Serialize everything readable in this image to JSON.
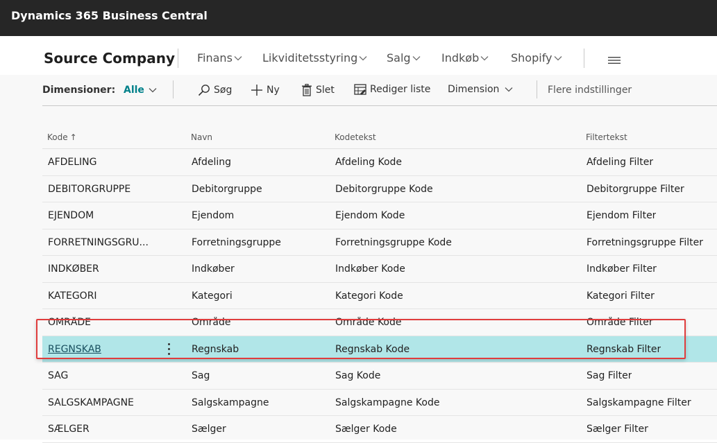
{
  "app": {
    "title": "Dynamics 365 Business Central"
  },
  "nav": {
    "company": "Source Company",
    "items": [
      {
        "label": "Finans"
      },
      {
        "label": "Likviditetsstyring"
      },
      {
        "label": "Salg"
      },
      {
        "label": "Indkøb"
      },
      {
        "label": "Shopify"
      }
    ]
  },
  "toolbar": {
    "filter_label": "Dimensioner:",
    "filter_value": "Alle",
    "search_label": "Søg",
    "new_label": "Ny",
    "delete_label": "Slet",
    "edit_list_label": "Rediger liste",
    "dimension_label": "Dimension",
    "more_label": "Flere indstillinger"
  },
  "table": {
    "columns": [
      "Kode",
      "Navn",
      "Kodetekst",
      "Filtertekst"
    ],
    "sort_indicator": "↑",
    "rows": [
      {
        "code": "AFDELING",
        "name": "Afdeling",
        "code_caption": "Afdeling Kode",
        "filter_caption": "Afdeling Filter"
      },
      {
        "code": "DEBITORGRUPPE",
        "name": "Debitorgruppe",
        "code_caption": "Debitorgruppe Kode",
        "filter_caption": "Debitorgruppe Filter"
      },
      {
        "code": "EJENDOM",
        "name": "Ejendom",
        "code_caption": "Ejendom Kode",
        "filter_caption": "Ejendom Filter"
      },
      {
        "code": "FORRETNINGSGRU...",
        "name": "Forretningsgruppe",
        "code_caption": "Forretningsgruppe Kode",
        "filter_caption": "Forretningsgruppe Filter"
      },
      {
        "code": "INDKØBER",
        "name": "Indkøber",
        "code_caption": "Indkøber Kode",
        "filter_caption": "Indkøber Filter"
      },
      {
        "code": "KATEGORI",
        "name": "Kategori",
        "code_caption": "Kategori Kode",
        "filter_caption": "Kategori Filter"
      },
      {
        "code": "OMRÅDE",
        "name": "Område",
        "code_caption": "Område Kode",
        "filter_caption": "Område Filter"
      },
      {
        "code": "REGNSKAB",
        "name": "Regnskab",
        "code_caption": "Regnskab Kode",
        "filter_caption": "Regnskab Filter"
      },
      {
        "code": "SAG",
        "name": "Sag",
        "code_caption": "Sag Kode",
        "filter_caption": "Sag Filter"
      },
      {
        "code": "SALGSKAMPAGNE",
        "name": "Salgskampagne",
        "code_caption": "Salgskampagne Kode",
        "filter_caption": "Salgskampagne Filter"
      },
      {
        "code": "SÆLGER",
        "name": "Sælger",
        "code_caption": "Sælger Kode",
        "filter_caption": "Sælger Filter"
      }
    ]
  },
  "colors": {
    "topbar": "#262626",
    "accent": "#00818a",
    "selected_row": "#b1e6e8",
    "highlight_border": "#e03c3c"
  }
}
